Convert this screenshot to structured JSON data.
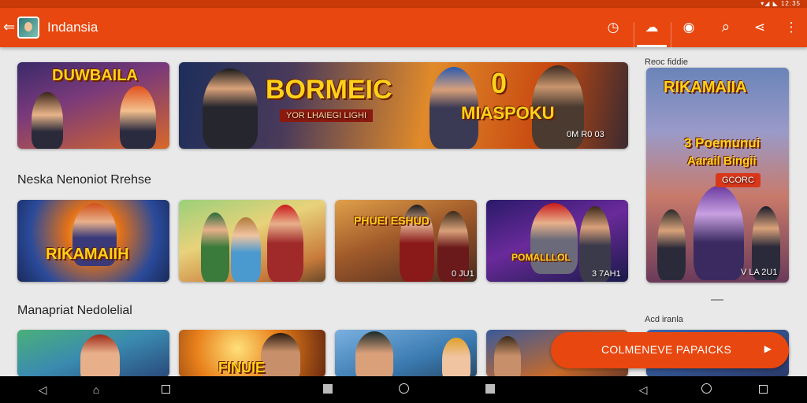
{
  "status": {
    "right_text": "▾◢ ◣ 12:35"
  },
  "appbar": {
    "back_icon": "arrow-left-icon",
    "title": "Indansia",
    "actions": [
      {
        "name": "timer-icon",
        "glyph": "◷"
      },
      {
        "name": "cloud-icon",
        "glyph": "☁"
      },
      {
        "name": "coin-icon",
        "glyph": "◉"
      },
      {
        "name": "search-icon",
        "glyph": "⌕"
      },
      {
        "name": "share-icon",
        "glyph": "⋖"
      },
      {
        "name": "more-vert-icon",
        "glyph": "⋮"
      }
    ]
  },
  "banners": [
    {
      "caption": "DUWBAILA"
    },
    {
      "caption": "BORMEIC",
      "subtitle": "YOR LHAIEGI LIGHI",
      "badge": "MIASPOKU",
      "corner": "0",
      "tag": "0M R0 03"
    }
  ],
  "side_top": {
    "label": "Reoc fiddie",
    "caption": "RIKAMAIIA",
    "line1": "3 Poemunui",
    "line2": "Aarail Bingii",
    "button": "GCORC",
    "tag": "V LA 2U1"
  },
  "sections": [
    {
      "title": "Neska Nenoniot Rrehse"
    },
    {
      "title": "Manapriat Nedolelial"
    }
  ],
  "row1": [
    {
      "caption": "RIKAMAIIH"
    },
    {
      "caption": ""
    },
    {
      "caption": "PHUEI ESHUD",
      "tag": "0 JU1"
    },
    {
      "caption": "POMALLLOL",
      "tag": "3 7AH1"
    }
  ],
  "side_bottom": {
    "label": "Acd iranla"
  },
  "row2": [
    {
      "caption": ""
    },
    {
      "caption": "FINUIE"
    },
    {
      "caption": ""
    },
    {
      "caption": ""
    }
  ],
  "cta": {
    "label": "COLMENEVE PAPAICKS",
    "arrow": "▶"
  },
  "colors": {
    "accent": "#e8470f",
    "statusbar": "#c93a08",
    "background": "#e9e9e9"
  }
}
